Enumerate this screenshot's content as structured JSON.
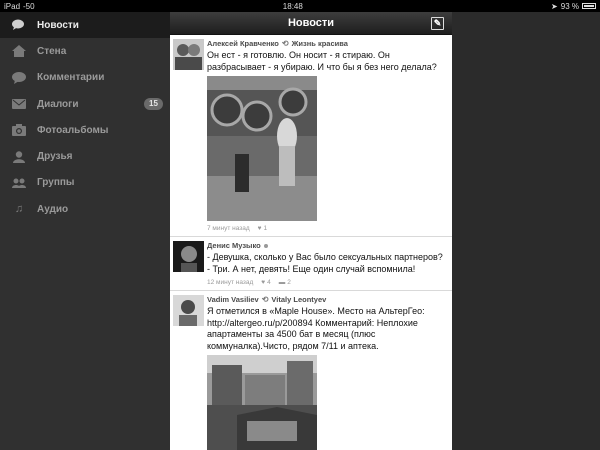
{
  "statusbar": {
    "carrier": "iPad",
    "signal": "-50",
    "time": "18:48",
    "battery": "93 %"
  },
  "sidebar": {
    "items": [
      {
        "label": "Новости",
        "icon": "chat-bubbles-icon",
        "active": true
      },
      {
        "label": "Стена",
        "icon": "home-icon"
      },
      {
        "label": "Комментарии",
        "icon": "comment-icon"
      },
      {
        "label": "Диалоги",
        "icon": "message-icon",
        "badge": "15"
      },
      {
        "label": "Фотоальбомы",
        "icon": "camera-icon"
      },
      {
        "label": "Друзья",
        "icon": "person-icon"
      },
      {
        "label": "Группы",
        "icon": "group-icon"
      },
      {
        "label": "Аудио",
        "icon": "music-note-icon"
      }
    ]
  },
  "header": {
    "title": "Новости",
    "compose_icon": "compose-icon"
  },
  "feed": {
    "posts": [
      {
        "author": "Алексей Кравченко",
        "repost": "Жизнь красива",
        "text": "Он ест - я готовлю. Он носит - я стираю. Он разбрасывает - я убираю. И что бы я без него делала?",
        "time": "7 минут назад",
        "likes": "1"
      },
      {
        "author": "Денис Музыко",
        "text": "- Девушка, сколько у Вас было сексуальных партнеров? - Три. А нет, девять! Еще один случай вспомнила!",
        "time": "12 минут назад",
        "likes": "4",
        "comments": "2"
      },
      {
        "author": "Vadim Vasiliev",
        "repost": "Vitaly Leontyev",
        "text": "Я отметился в «Maple House». Место на АльтерГео: http://altergeo.ru/p/200894 Комментарий: Неплохие апартаменты за 4500 бат в месяц (плюс коммуналка).Чисто, рядом 7/11 и аптека."
      }
    ]
  }
}
